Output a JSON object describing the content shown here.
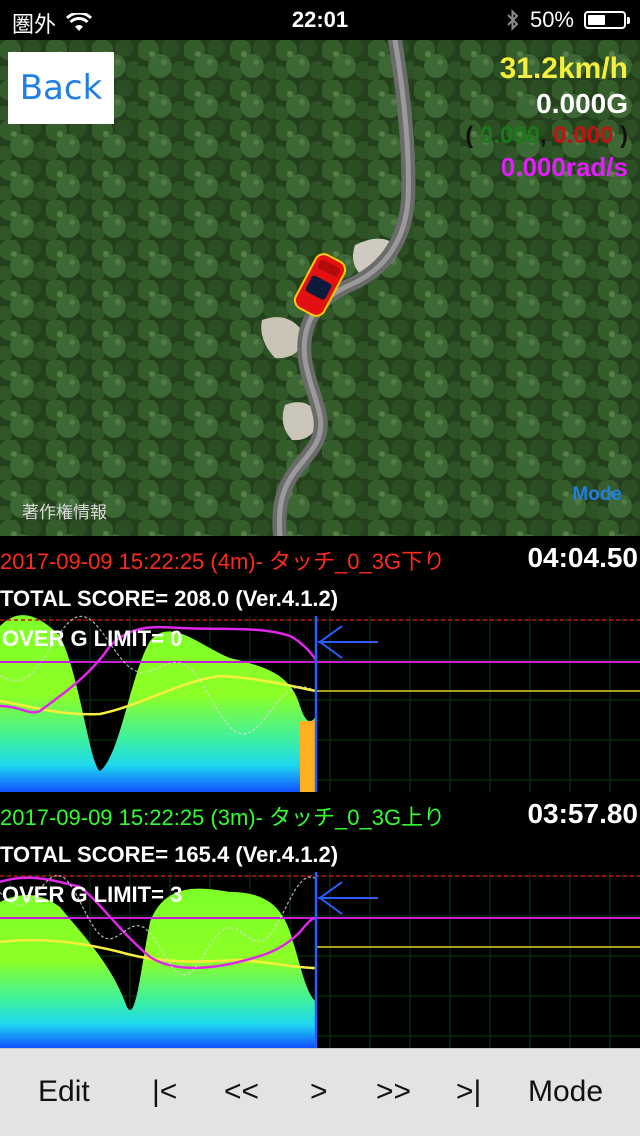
{
  "status_bar": {
    "carrier": "圏外",
    "time": "22:01",
    "battery_percent": "50%",
    "battery_level": 0.5
  },
  "map": {
    "back_label": "Back",
    "speed": "31.2km/h",
    "g_total": "0.000G",
    "paren_open": "(",
    "g_x": "0.000",
    "comma": ",",
    "g_y": "0.000",
    "paren_close": ")",
    "yaw_rate": "0.000rad/s",
    "copyright": "著作権情報",
    "mode_label": "Mode"
  },
  "panels": [
    {
      "title": "2017-09-09 15:22:25 (4m)- タッチ_0_3G下り",
      "lap_time": "04:04.50",
      "total_score": "TOTAL SCORE= 208.0 (Ver.4.1.2)",
      "over_g_limit": "OVER G LIMIT= 0"
    },
    {
      "title": "2017-09-09 15:22:25 (3m)- タッチ_0_3G上り",
      "lap_time": "03:57.80",
      "total_score": "TOTAL SCORE= 165.4 (Ver.4.1.2)",
      "over_g_limit": "OVER G LIMIT= 3"
    }
  ],
  "toolbar": {
    "edit": "Edit",
    "first": "|<",
    "rewind": "<<",
    "play": ">",
    "forward": ">>",
    "last": ">|",
    "mode": "Mode"
  },
  "colors": {
    "accent_blue": "#1f7fe6",
    "speed_yellow": "#f4ef3c",
    "yaw_magenta": "#e41cff",
    "title_red": "#ff2a1a",
    "title_green": "#2eff2e"
  }
}
